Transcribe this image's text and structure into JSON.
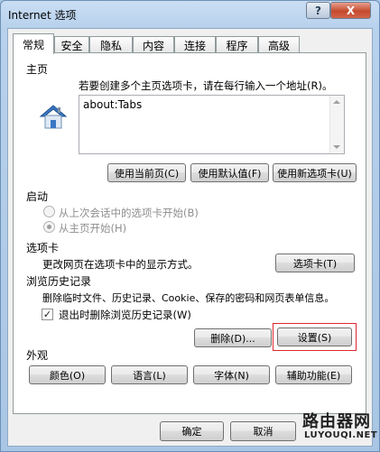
{
  "window": {
    "title": "Internet 选项",
    "help_label": "?",
    "close_label": "X"
  },
  "tabs": [
    {
      "label": "常规"
    },
    {
      "label": "安全"
    },
    {
      "label": "隐私"
    },
    {
      "label": "内容"
    },
    {
      "label": "连接"
    },
    {
      "label": "程序"
    },
    {
      "label": "高级"
    }
  ],
  "homepage": {
    "heading": "主页",
    "instruction": "若要创建多个主页选项卡，请在每行输入一个地址(R)。",
    "url_value": "about:Tabs",
    "icon": "house-icon",
    "use_current": "使用当前页(C)",
    "use_default": "使用默认值(F)",
    "use_new_tab": "使用新选项卡(U)"
  },
  "startup": {
    "heading": "启动",
    "option_last_session": "从上次会话中的选项卡开始(B)",
    "option_homepage": "从主页开始(H)",
    "selected": "从主页开始(H)"
  },
  "tabs_section": {
    "heading": "选项卡",
    "description": "更改网页在选项卡中的显示方式。",
    "settings_button": "选项卡(T)"
  },
  "history": {
    "heading": "浏览历史记录",
    "description": "删除临时文件、历史记录、Cookie、保存的密码和网页表单信息。",
    "delete_on_exit_label": "退出时删除浏览历史记录(W)",
    "delete_on_exit_checked": true,
    "check_mark": "✓",
    "delete_button": "删除(D)...",
    "settings_button": "设置(S)",
    "highlight_color": "#e0262e"
  },
  "appearance": {
    "heading": "外观",
    "colors_button": "颜色(O)",
    "languages_button": "语言(L)",
    "fonts_button": "字体(N)",
    "accessibility_button": "辅助功能(E)"
  },
  "footer": {
    "ok_button": "确定",
    "cancel_button": "取消"
  },
  "watermark": {
    "title": "路由器网",
    "url": "LUYOUQI.NET"
  }
}
